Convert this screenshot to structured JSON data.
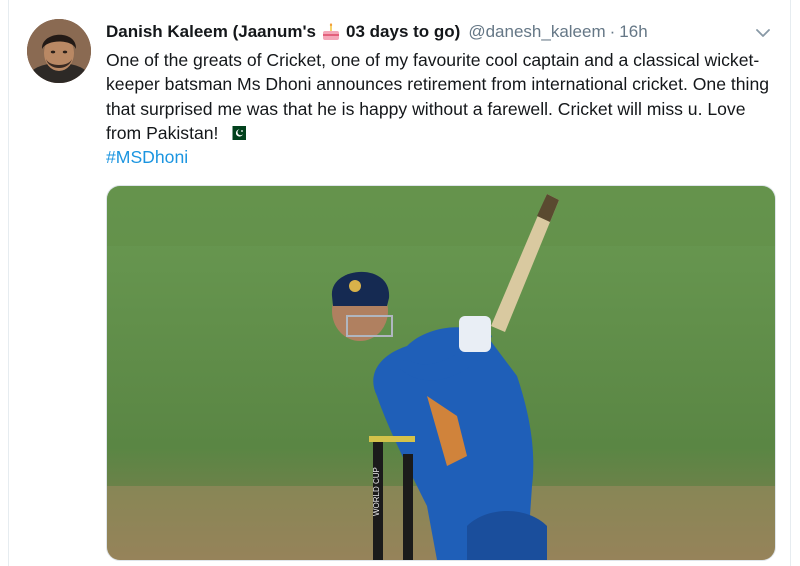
{
  "tweet": {
    "display_name": "Danish Kaleem (Jaanum's",
    "name_suffix": "03 days to go)",
    "handle": "@danesh_kaleem",
    "separator": "·",
    "time": "16h",
    "text": "One of the greats of Cricket, one of my favourite cool captain and a classical wicket-keeper batsman Ms Dhoni announces retirement from international cricket. One thing that surprised me was that he is happy without a farewell. Cricket will miss u. Love from Pakistan!",
    "hashtag": "#MSDhoni",
    "emoji_icons": [
      "birthday-cake-icon",
      "pakistan-flag-icon"
    ],
    "media": {
      "description_icon": "cricket-photo",
      "stump_text": "WORLD CUP"
    }
  },
  "colors": {
    "link": "#1b95e0",
    "secondary_text": "#657786",
    "primary_text": "#14171a",
    "field_green": "#5f8c4a",
    "jersey_blue": "#1f5fb8"
  }
}
